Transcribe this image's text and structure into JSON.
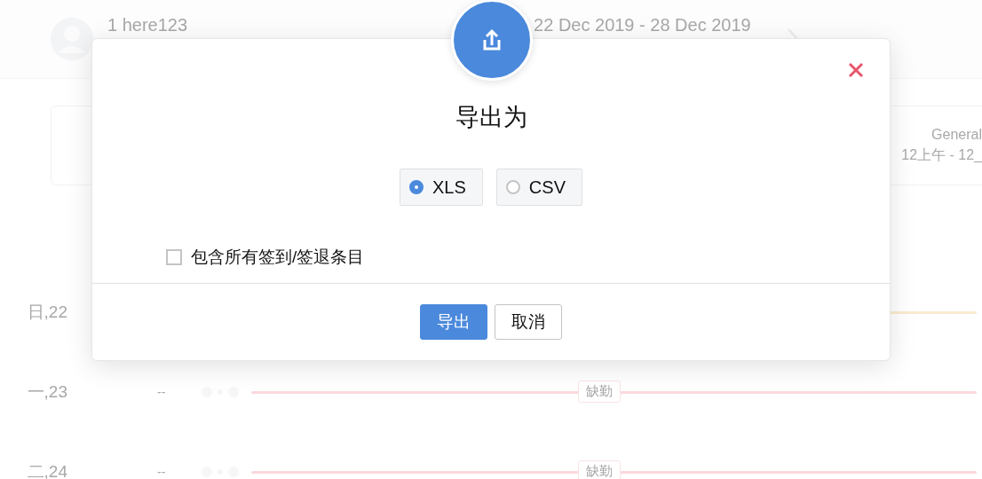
{
  "header": {
    "user_name": "1 here123",
    "date_range": "22 Dec 2019 - 28 Dec 2019"
  },
  "shift_card": {
    "name": "General",
    "hours": "12上午 - 12_"
  },
  "days": [
    {
      "label": "日,22",
      "color": "#fbecd0"
    },
    {
      "label": "一,23",
      "time": "--",
      "status": "缺勤",
      "color": "#f9d9dc"
    },
    {
      "label": "二,24",
      "time": "--",
      "status": "缺勤",
      "color": "#f9d9dc"
    }
  ],
  "dialog": {
    "title": "导出为",
    "formats": [
      {
        "label": "XLS",
        "selected": true
      },
      {
        "label": "CSV",
        "selected": false
      }
    ],
    "option": {
      "label": "包含所有签到/签退条目",
      "checked": false
    },
    "buttons": [
      {
        "kind": "primary",
        "label": "导出"
      },
      {
        "kind": "secondary",
        "label": "取消"
      }
    ]
  }
}
